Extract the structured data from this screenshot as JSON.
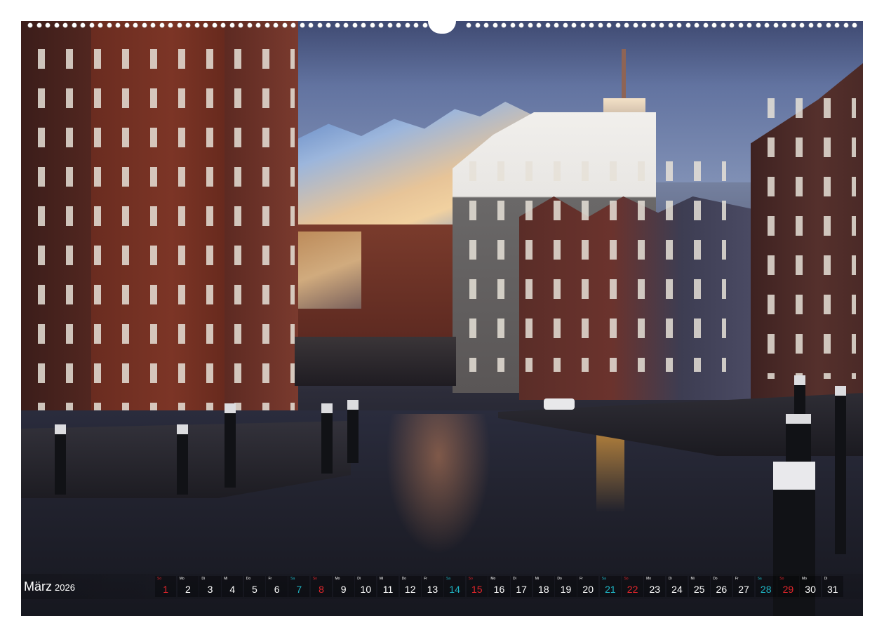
{
  "calendar": {
    "month": "März",
    "year": "2026",
    "days": [
      {
        "wd": "So",
        "num": "1",
        "type": "sun"
      },
      {
        "wd": "Mo",
        "num": "2",
        "type": "week"
      },
      {
        "wd": "Di",
        "num": "3",
        "type": "week"
      },
      {
        "wd": "Mi",
        "num": "4",
        "type": "week"
      },
      {
        "wd": "Do",
        "num": "5",
        "type": "week"
      },
      {
        "wd": "Fr",
        "num": "6",
        "type": "week"
      },
      {
        "wd": "Sa",
        "num": "7",
        "type": "sat"
      },
      {
        "wd": "So",
        "num": "8",
        "type": "sun"
      },
      {
        "wd": "Mo",
        "num": "9",
        "type": "week"
      },
      {
        "wd": "Di",
        "num": "10",
        "type": "week"
      },
      {
        "wd": "Mi",
        "num": "11",
        "type": "week"
      },
      {
        "wd": "Do",
        "num": "12",
        "type": "week"
      },
      {
        "wd": "Fr",
        "num": "13",
        "type": "week"
      },
      {
        "wd": "Sa",
        "num": "14",
        "type": "sat"
      },
      {
        "wd": "So",
        "num": "15",
        "type": "sun"
      },
      {
        "wd": "Mo",
        "num": "16",
        "type": "week"
      },
      {
        "wd": "Di",
        "num": "17",
        "type": "week"
      },
      {
        "wd": "Mi",
        "num": "18",
        "type": "week"
      },
      {
        "wd": "Do",
        "num": "19",
        "type": "week"
      },
      {
        "wd": "Fr",
        "num": "20",
        "type": "week"
      },
      {
        "wd": "Sa",
        "num": "21",
        "type": "sat"
      },
      {
        "wd": "So",
        "num": "22",
        "type": "sun"
      },
      {
        "wd": "Mo",
        "num": "23",
        "type": "week"
      },
      {
        "wd": "Di",
        "num": "24",
        "type": "week"
      },
      {
        "wd": "Mi",
        "num": "25",
        "type": "week"
      },
      {
        "wd": "Do",
        "num": "26",
        "type": "week"
      },
      {
        "wd": "Fr",
        "num": "27",
        "type": "week"
      },
      {
        "wd": "Sa",
        "num": "28",
        "type": "sat"
      },
      {
        "wd": "So",
        "num": "29",
        "type": "sun"
      },
      {
        "wd": "Mo",
        "num": "30",
        "type": "week"
      },
      {
        "wd": "Di",
        "num": "31",
        "type": "week"
      }
    ]
  },
  "colors": {
    "saturday": "#1fb5c4",
    "sunday": "#e2262b",
    "weekday": "#ffffff"
  }
}
